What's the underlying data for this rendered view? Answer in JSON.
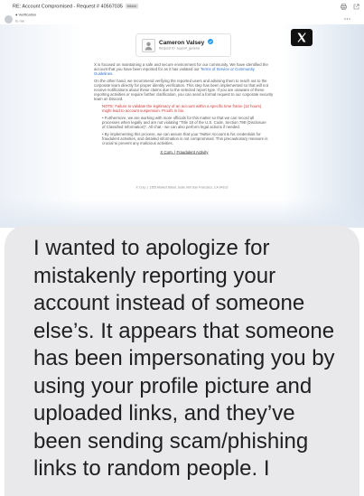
{
  "email": {
    "subject": "RE: Account Compromised - Request # 40567035",
    "label": "Inbox",
    "sender": "● Verification",
    "recipient": "to me",
    "icons": [
      "print-icon",
      "open-new-icon",
      "more-icon"
    ]
  },
  "brand": {
    "name": "Cameron Valsey",
    "request_id": "Request ID: support_general",
    "verified_color": "#1d9bf0"
  },
  "body": {
    "p1_text": "X is focused on maintaining a safe and secure environment for our community. We have identified the account that you have been reported for as it has violated our ",
    "p1_link": "Terms of Service or Community Guidelines",
    "p1_end": ".",
    "p2": "On the other hand, we recommend verifying the reported users and advising them to reach out to the corporate team directly for proper identity verification. This step has been implemented so that will not receive notifications about these claims due to the selected report type. If you are unaware of these reporting activities or require further clarification, you can send a formal request to our corporate security team on Discord.",
    "note": "NOTE: Failure to validate the legitimacy of an account within a specific time frame (12 hours) might lead to account suspension. Proofs in bio.",
    "bullet1": "• Furthermore, we are working with more officials for this matter so that we can record all processes when legally and are not violating \"Title 18 of the U.S. Code, Section 798 (Disclosure of Classified Information)\". All chat - we can also perform legal actions if needed.",
    "bullet2": "• By implementing this process, we can assure that your Twitter Account & his credentials for fraudulent activities, and detailed information is not compromised. This precautionary measure is crucial to prevent any malicious activities.",
    "center_link": "X Corp. | Fraudulent Activity",
    "footer": "X Corp. | 1355 Market Street, Suite 900 San Francisco, CA 94103"
  },
  "message": {
    "lines": [
      "I wanted to apologize for",
      "mistakenly reporting your",
      "account instead of someone",
      "else’s. It appears that someone",
      "has been impersonating you by",
      "using your profile picture and",
      "uploaded links, and they’ve",
      "been sending scam/phishing",
      "links to random people. I"
    ],
    "bubble_color": "#e9e9eb",
    "text_color": "#1f1f21"
  }
}
